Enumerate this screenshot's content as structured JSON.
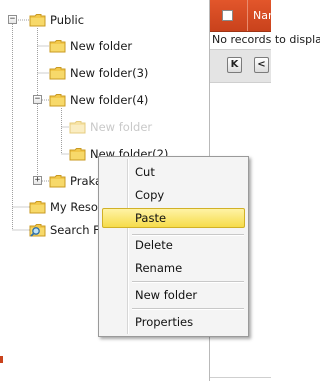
{
  "tree": {
    "nodes": [
      {
        "label": "Public",
        "expanded": true
      },
      {
        "label": "New folder"
      },
      {
        "label": "New folder(3)"
      },
      {
        "label": "New folder(4)",
        "expanded": true
      },
      {
        "label": "New folder",
        "state": "dragging"
      },
      {
        "label": "New folder(2)"
      },
      {
        "label": "Prakash",
        "expanded": false
      },
      {
        "label": "My Resources"
      },
      {
        "label": "Search Folder"
      }
    ],
    "icons": {
      "folder": "folder-icon",
      "search_folder": "search-folder-icon"
    },
    "colors": {
      "folder_fill": "#f2c84b",
      "folder_dark": "#d9a52a",
      "ghost_folder": "#f7e3a6"
    }
  },
  "grid": {
    "header_name": "Name",
    "empty_text": "No records to display.",
    "header_color": "#d54a22",
    "pager": {
      "first_glyph": "K",
      "prev_glyph": "<"
    }
  },
  "context_menu": {
    "items": [
      {
        "label": "Cut"
      },
      {
        "label": "Copy"
      },
      {
        "label": "Paste",
        "highlighted": true
      },
      {
        "label": "Delete"
      },
      {
        "label": "Rename"
      },
      {
        "label": "New folder"
      },
      {
        "label": "Properties"
      }
    ],
    "highlight_color": "#f6dc4a"
  }
}
